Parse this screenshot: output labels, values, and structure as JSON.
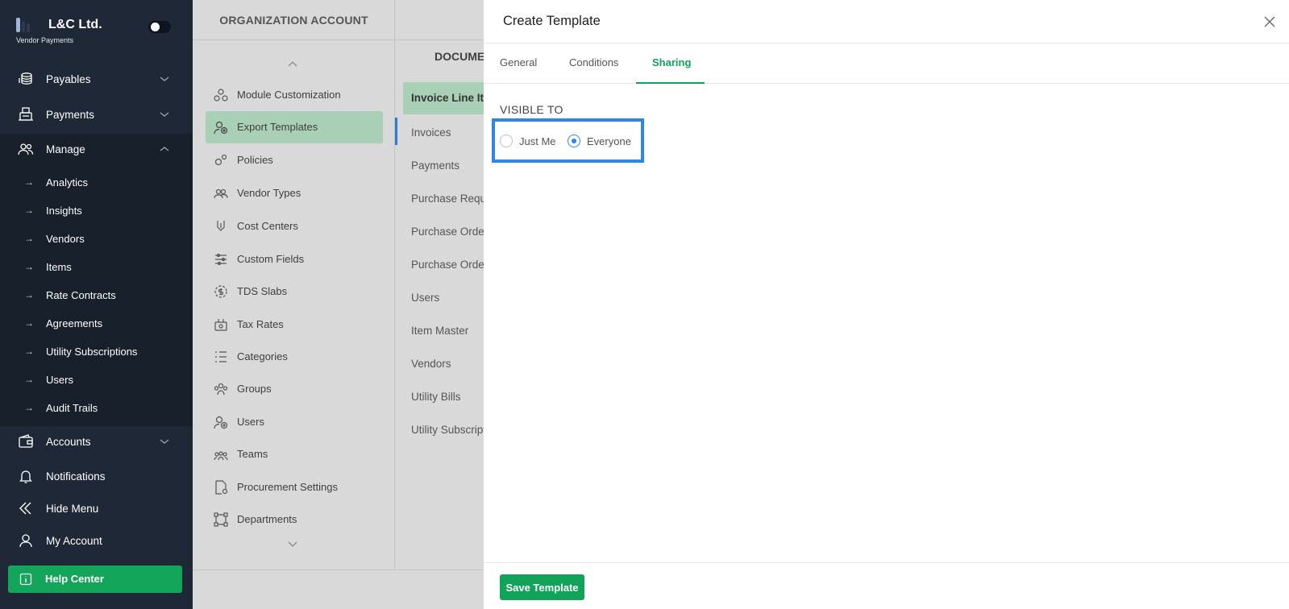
{
  "brand": {
    "name": "L&C Ltd.",
    "subtitle": "Vendor Payments"
  },
  "sidebar": {
    "items": [
      {
        "label": "Payables",
        "icon": "coins-icon"
      },
      {
        "label": "Payments",
        "icon": "register-icon"
      },
      {
        "label": "Manage",
        "icon": "users-group-icon"
      },
      {
        "label": "Accounts",
        "icon": "wallet-icon"
      },
      {
        "label": "Notifications",
        "icon": "bell-icon"
      },
      {
        "label": "Hide Menu",
        "icon": "double-chevron-left-icon"
      },
      {
        "label": "My Account",
        "icon": "user-icon"
      }
    ],
    "manage_subitems": [
      "Analytics",
      "Insights",
      "Vendors",
      "Items",
      "Rate Contracts",
      "Agreements",
      "Utility Subscriptions",
      "Users",
      "Audit Trails"
    ],
    "help_center": "Help Center",
    "sub_arrow": "→"
  },
  "org_panel": {
    "title": "ORGANIZATION ACCOUNT",
    "items": [
      "Module Customization",
      "Export Templates",
      "Policies",
      "Vendor Types",
      "Cost Centers",
      "Custom Fields",
      "TDS Slabs",
      "Tax Rates",
      "Categories",
      "Groups",
      "Users",
      "Teams",
      "Procurement Settings",
      "Departments"
    ],
    "active": "Export Templates"
  },
  "doc_panel": {
    "title": "DOCUMENT TYPES",
    "items": [
      "Invoice Line Items",
      "Invoices",
      "Payments",
      "Purchase Requests",
      "Purchase Orders",
      "Purchase Order Items",
      "Users",
      "Item Master",
      "Vendors",
      "Utility Bills",
      "Utility Subscriptions"
    ],
    "active": "Invoice Line Items"
  },
  "modal": {
    "title": "Create Template",
    "tabs": [
      "General",
      "Conditions",
      "Sharing"
    ],
    "active_tab": "Sharing",
    "visible_to_label": "VISIBLE TO",
    "options": [
      "Just Me",
      "Everyone"
    ],
    "selected": "Everyone",
    "save_label": "Save Template"
  },
  "colors": {
    "sidebar_bg": "#1f2837",
    "accent_green": "#12a35a",
    "focus_blue": "#2f86ea",
    "active_bg": "#a9d0b7"
  }
}
